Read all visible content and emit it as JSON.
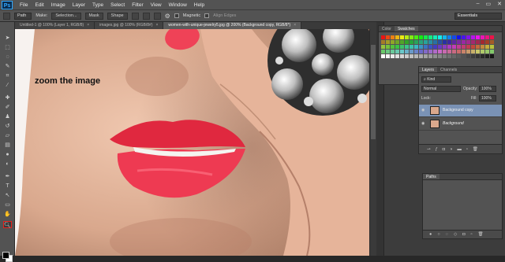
{
  "app": {
    "logo": "Ps"
  },
  "menu": [
    "File",
    "Edit",
    "Image",
    "Layer",
    "Type",
    "Select",
    "Filter",
    "View",
    "Window",
    "Help"
  ],
  "window_controls": {
    "minimize": "–",
    "restore": "▭",
    "close": "✕"
  },
  "options": {
    "path_mode": "Path",
    "make_label": "Make:",
    "selection_btn": "Selection...",
    "mask_btn": "Mask",
    "shape_btn": "Shape",
    "magnetic_label": "Magnetic",
    "align_edges_label": "Align Edges",
    "workspace": "Essentials"
  },
  "tabs": [
    {
      "label": "Untitled-1 @ 100% (Layer 1, RGB/8)"
    },
    {
      "label": "images.jpg @ 100% (RGB/8#)"
    },
    {
      "label": "women-with-unique-jewelry5.jpg @ 200% (Background copy, RGB/8*)"
    }
  ],
  "tab_close": "×",
  "canvas": {
    "annotation": "zoom the image"
  },
  "swatches_panel": {
    "tabs": [
      "Color",
      "Swatches"
    ]
  },
  "layers_panel": {
    "tabs": [
      "Layers",
      "Channels"
    ],
    "kind": "Kind",
    "blend_mode": "Normal",
    "opacity_label": "Opacity:",
    "opacity_value": "100%",
    "lock_label": "Lock:",
    "fill_label": "Fill:",
    "fill_value": "100%",
    "layers": [
      {
        "name": "Background copy",
        "selected": true
      },
      {
        "name": "Background",
        "selected": false
      }
    ],
    "footer_icons": [
      "link-icon",
      "fx-icon",
      "mask-icon",
      "adjustment-icon",
      "folder-icon",
      "new-layer-icon",
      "trash-icon"
    ]
  },
  "paths_panel": {
    "tabs": [
      "Paths"
    ]
  },
  "colors": {
    "accent_selected_layer": "#7a92b5",
    "zoom_tool_highlight": "#e8211c",
    "ps_logo_bg": "#0b2a4a",
    "ps_logo_fg": "#31a8ff"
  }
}
